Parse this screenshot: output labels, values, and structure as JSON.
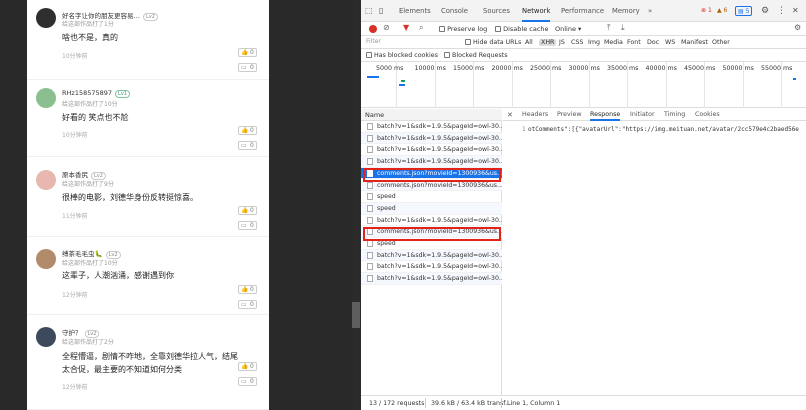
{
  "comments": [
    {
      "username": "好名字让你的朋友更容易…",
      "level": "Lv2",
      "level_green": false,
      "desc": "给这部作品打了1分",
      "text": "啥也不是，真的",
      "time": "10分钟前",
      "likes": "0",
      "replies": "0",
      "avatar_color": "#2f2f2f"
    },
    {
      "username": "RHz158575897",
      "level": "Lv1",
      "level_green": true,
      "desc": "给这部作品打了10分",
      "text": "好看的 笑点也不尬",
      "time": "10分钟前",
      "likes": "0",
      "replies": "0",
      "avatar_color": "#8bbf8f"
    },
    {
      "username": "原本香尻",
      "level": "Lv2",
      "level_green": false,
      "desc": "给这部作品打了9分",
      "text": "很棒的电影，刘德华身份反转挺惊喜。",
      "time": "11分钟前",
      "likes": "0",
      "replies": "0",
      "avatar_color": "#e8b7b0"
    },
    {
      "username": "缚茶毛毛虫🐛",
      "level": "Lv2",
      "level_green": false,
      "desc": "给这部作品打了10分",
      "text": "这辈子，人潮汹涌，感谢遇到你",
      "time": "12分钟前",
      "likes": "0",
      "replies": "0",
      "avatar_color": "#b28b6a"
    },
    {
      "username": "守护？",
      "level": "Lv2",
      "level_green": false,
      "desc": "给这部作品打了2分",
      "text": "全程懵逼，剧情不咋地，全靠刘德华拉人气，结尾太合促，最主要的不知道如何分类",
      "time": "12分钟前",
      "likes": "0",
      "replies": "0",
      "avatar_color": "#3c4a5c"
    }
  ],
  "devtools": {
    "tabs": [
      "Elements",
      "Console",
      "Sources",
      "Network",
      "Performance",
      "Memory"
    ],
    "more": "»",
    "errors": "1",
    "warnings": "6",
    "info": "5",
    "toolbar": {
      "preserve_log": "Preserve log",
      "disable_cache": "Disable cache",
      "throttle": "Online"
    },
    "filter": {
      "placeholder": "Filter",
      "hide_data_urls": "Hide data URLs",
      "types": [
        "All",
        "XHR",
        "JS",
        "CSS",
        "Img",
        "Media",
        "Font",
        "Doc",
        "WS",
        "Manifest",
        "Other"
      ],
      "selected": "XHR"
    },
    "has_blocked_cookies": "Has blocked cookies",
    "blocked_requests": "Blocked Requests",
    "timeline_labels": [
      "5000 ms",
      "10000 ms",
      "15000 ms",
      "20000 ms",
      "25000 ms",
      "30000 ms",
      "35000 ms",
      "40000 ms",
      "45000 ms",
      "50000 ms",
      "55000 ms"
    ],
    "name_header": "Name",
    "requests": [
      "batch?v=1&sdk=1.9.5&pageId=owl-30...",
      "batch?v=1&sdk=1.9.5&pageId=owl-30...",
      "batch?v=1&sdk=1.9.5&pageId=owl-30...",
      "batch?v=1&sdk=1.9.5&pageId=owl-30...",
      "comments.json?movieId=1300936&us...",
      "comments.json?movieId=1300936&us...",
      "speed",
      "speed",
      "batch?v=1&sdk=1.9.5&pageId=owl-30...",
      "comments.json?movieId=1300936&us...",
      "speed",
      "batch?v=1&sdk=1.9.5&pageId=owl-30...",
      "batch?v=1&sdk=1.9.5&pageId=owl-30...",
      "batch?v=1&sdk=1.9.5&pageId=owl-30..."
    ],
    "detail_tabs": [
      "Headers",
      "Preview",
      "Response",
      "Initiator",
      "Timing",
      "Cookies"
    ],
    "detail_active": "Response",
    "response_line_no": "1",
    "response_text": "otComments\":[{\"avatarUrl\":\"https://img.meituan.net/avatar/2cc579e4c2baed56e",
    "status": {
      "requests": "13 / 172 requests",
      "transferred": "39.6 kB / 63.4 kB transf...",
      "position": "Line 1, Column 1"
    }
  }
}
